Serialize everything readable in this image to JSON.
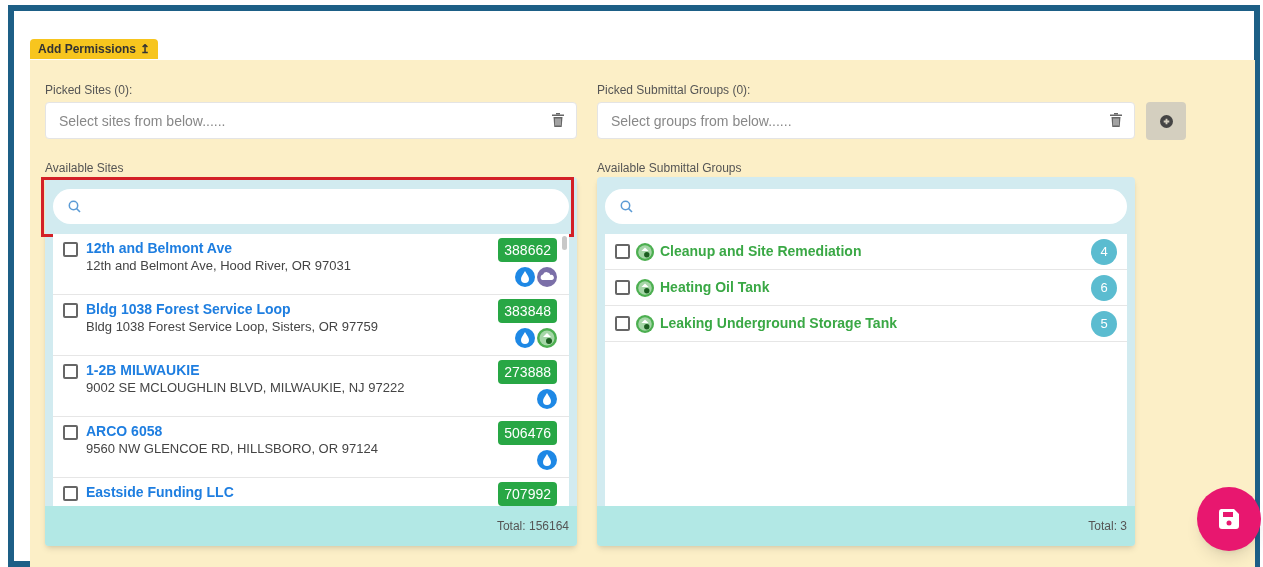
{
  "tab": {
    "label": "Add Permissions",
    "icon": "↥"
  },
  "picked_sites": {
    "label": "Picked Sites (0):",
    "placeholder": "Select sites from below......"
  },
  "picked_groups": {
    "label": "Picked Submittal Groups (0):",
    "placeholder": "Select groups from below......"
  },
  "available_sites": {
    "label": "Available Sites",
    "search_highlighted": true,
    "total": "Total: 156164",
    "rows": [
      {
        "name": "12th and Belmont Ave",
        "address": "12th and Belmont Ave, Hood River, OR 97031",
        "code": "388662",
        "checked": false,
        "icons": [
          {
            "kind": "drop"
          },
          {
            "kind": "cloud"
          }
        ]
      },
      {
        "name": "Bldg 1038 Forest Service Loop",
        "address": "Bldg 1038 Forest Service Loop, Sisters, OR 97759",
        "code": "383848",
        "checked": false,
        "icons": [
          {
            "kind": "drop"
          },
          {
            "kind": "tank"
          }
        ]
      },
      {
        "name": "1-2B MILWAUKIE",
        "address": "9002 SE MCLOUGHLIN BLVD, MILWAUKIE, NJ 97222",
        "code": "273888",
        "checked": false,
        "icons": [
          {
            "kind": "drop"
          }
        ]
      },
      {
        "name": "ARCO 6058",
        "address": "9560 NW GLENCOE RD, HILLSBORO, OR 97124",
        "code": "506476",
        "checked": false,
        "icons": [
          {
            "kind": "drop"
          }
        ]
      },
      {
        "name": "Eastside Funding LLC",
        "code": "707992",
        "checked": false
      }
    ]
  },
  "available_groups": {
    "label": "Available Submittal Groups",
    "search_highlighted": false,
    "total": "Total: 3",
    "rows": [
      {
        "name": "Cleanup and Site Remediation",
        "count": "4",
        "checked": false
      },
      {
        "name": "Heating Oil Tank",
        "count": "6",
        "checked": false
      },
      {
        "name": "Leaking Underground Storage Tank",
        "count": "5",
        "checked": false
      }
    ]
  }
}
